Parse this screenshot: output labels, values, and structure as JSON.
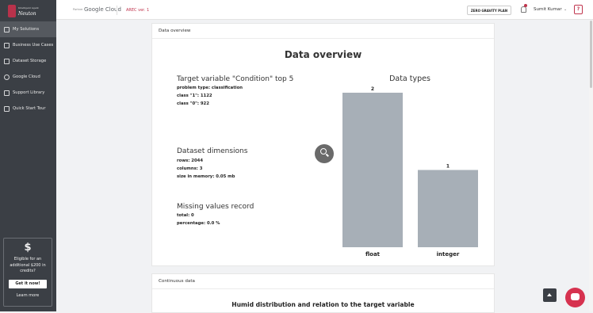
{
  "sidebar": {
    "logo_small": "Intelligent Agent",
    "logo_name": "Neuton",
    "items": [
      {
        "label": "My Solutions",
        "icon": "monitor-icon"
      },
      {
        "label": "Business Use Cases",
        "icon": "briefcase-icon"
      },
      {
        "label": "Dataset Storage",
        "icon": "layers-icon"
      },
      {
        "label": "Google Cloud",
        "icon": "google-icon"
      },
      {
        "label": "Support Library",
        "icon": "book-icon"
      },
      {
        "label": "Quick Start Tour",
        "icon": "tour-icon"
      }
    ],
    "promo": {
      "symbol": "$",
      "text": "Eligible for an additional $200 in credits?",
      "button": "Get it now!",
      "link": "Learn more"
    }
  },
  "topbar": {
    "partner": "Partner",
    "cloud": "Google Cloud",
    "version": "AREC ver. 1",
    "plan": "ZERO GRAVITY PLAN",
    "user": "Sumit Kumar",
    "help": "?"
  },
  "overview": {
    "header": "Data overview",
    "title": "Data overview",
    "target": {
      "title": "Target variable \"Condition\" top 5",
      "lines": [
        "problem type: classification",
        "class \"1\": 1122",
        "class \"0\": 922"
      ]
    },
    "dimensions": {
      "title": "Dataset dimensions",
      "lines": [
        "rows: 2044",
        "columns: 3",
        "size in memory: 0.05 mb"
      ]
    },
    "missing": {
      "title": "Missing values record",
      "lines": [
        "total: 0",
        "percentage: 0.0 %"
      ]
    }
  },
  "chart_data": {
    "type": "bar",
    "title": "Data types",
    "categories": [
      "float",
      "integer"
    ],
    "values": [
      2,
      1
    ],
    "ylim": [
      0,
      2
    ],
    "bar_color": "#a7afb7",
    "grid": false
  },
  "continuous": {
    "header": "Continuous data",
    "title": "Humid distribution and relation to the target variable"
  },
  "colors": {
    "accent": "#c0344d",
    "sidebar_bg": "#3b3f45",
    "chat": "#d6324f"
  }
}
